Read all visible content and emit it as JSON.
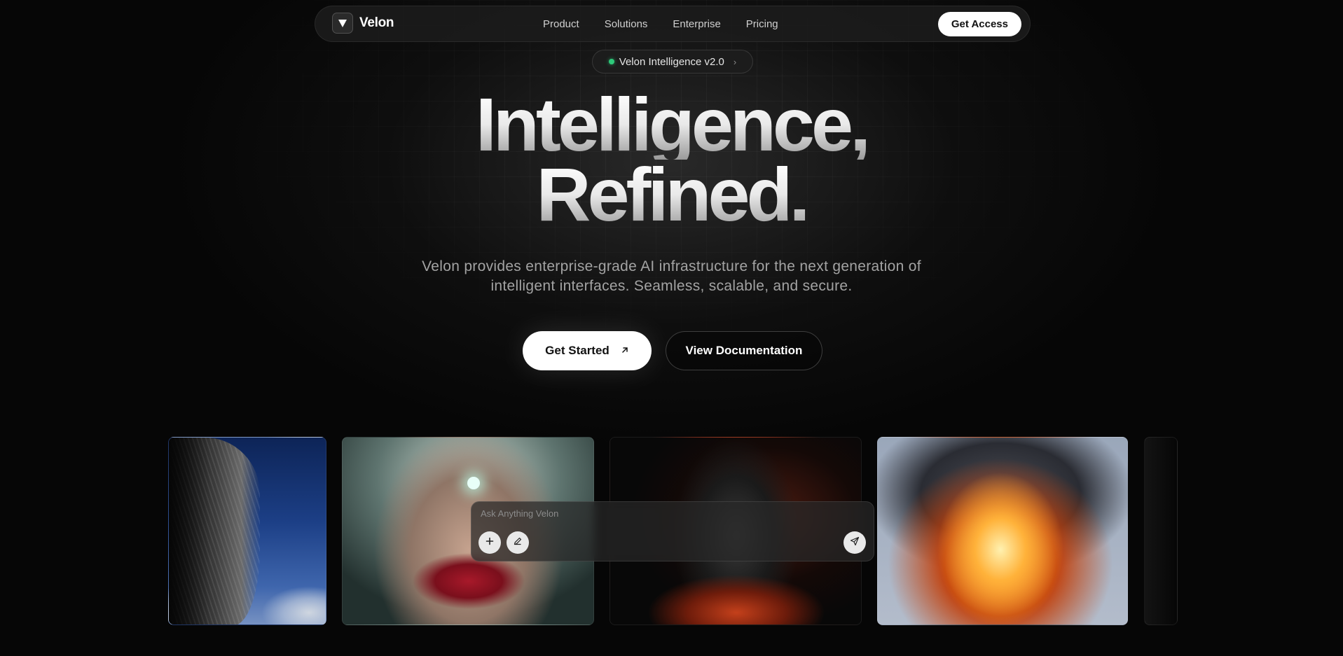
{
  "brand": {
    "name": "Velon",
    "logo_icon": "triangle-down-icon"
  },
  "nav": {
    "links": [
      "Product",
      "Solutions",
      "Enterprise",
      "Pricing"
    ],
    "cta": "Get Access"
  },
  "badge": {
    "label": "Velon Intelligence v2.0",
    "status_color": "#2ec97a",
    "icon": "chevron-right-icon"
  },
  "hero": {
    "title_line1": "Intelligence,",
    "title_line2": "Refined.",
    "subtitle": "Velon provides enterprise-grade AI infrastructure for the next generation of intelligent interfaces. Seamless, scalable, and secure.",
    "primary_cta": "Get Started",
    "primary_cta_icon": "arrow-up-right-icon",
    "secondary_cta": "View Documentation"
  },
  "gallery": {
    "cards": [
      "sky-fabric-image",
      "astronaut-portrait-image",
      "burning-statue-image",
      "explosion-image"
    ]
  },
  "prompt": {
    "placeholder": "Ask Anything Velon",
    "value": "",
    "add_icon": "plus-icon",
    "edit_icon": "pen-icon",
    "send_icon": "send-icon"
  },
  "colors": {
    "background": "#060606",
    "accent": "#ffffff",
    "status": "#2ec97a"
  }
}
